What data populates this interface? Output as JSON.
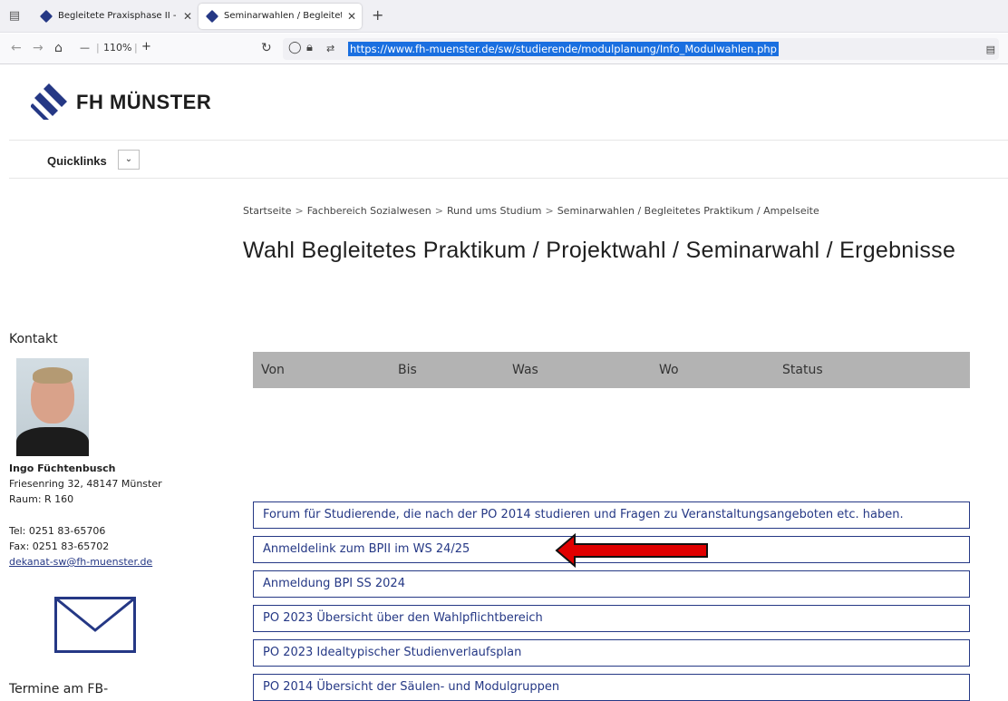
{
  "browser": {
    "tabs": [
      {
        "title": "Begleitete Praxisphase II - Fachl",
        "active": false
      },
      {
        "title": "Seminarwahlen / Begleitetes Pr",
        "active": true
      }
    ],
    "zoom": "110%",
    "url": "https://www.fh-muenster.de/sw/studierende/modulplanung/Info_Modulwahlen.php"
  },
  "header": {
    "brand": "FH MÜNSTER",
    "quicklinks": "Quicklinks"
  },
  "breadcrumb": [
    "Startseite",
    "Fachbereich Sozialwesen",
    "Rund ums Studium",
    "Seminarwahlen / Begleitetes Praktikum / Ampelseite"
  ],
  "page_title": "Wahl Begleitetes Praktikum / Projektwahl / Seminarwahl / Ergebnisse",
  "contact": {
    "heading": "Kontakt",
    "name": "Ingo Füchtenbusch",
    "address": "Friesenring 32, 48147 Münster",
    "room": "Raum: R 160",
    "tel": "Tel: 0251 83-65706",
    "fax": "Fax: 0251 83-65702",
    "email": "dekanat-sw@fh-muenster.de"
  },
  "termine_heading": "Termine am FB-",
  "table": {
    "headers": [
      "Von",
      "Bis",
      "Was",
      "Wo",
      "Status"
    ]
  },
  "links": [
    "Forum für Studierende, die nach der PO 2014 studieren und Fragen zu Veranstaltungsangeboten etc. haben.",
    "Anmeldelink zum BPII im WS 24/25",
    "Anmeldung BPI SS 2024",
    "PO 2023 Übersicht über den Wahlpflichtbereich",
    "PO 2023 Idealtypischer Studienverlaufsplan",
    "PO 2014 Übersicht der Säulen- und Modulgruppen"
  ],
  "colors": {
    "brand_blue": "#253885",
    "arrow_red": "#e00000"
  }
}
